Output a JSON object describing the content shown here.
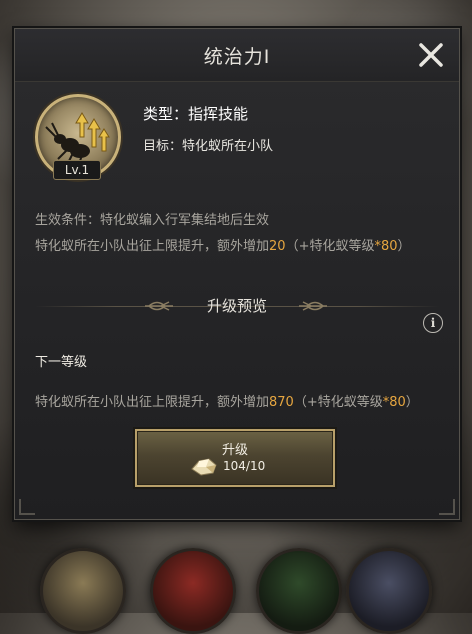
{
  "dialog": {
    "title": "统治力I",
    "close_icon": "close-icon"
  },
  "skill": {
    "level": "Lv.1",
    "type_text": "类型：指挥技能",
    "target_text": "目标：特化蚁所在小队",
    "icon": "ant-arrows-up-icon"
  },
  "current_effect": {
    "condition_text": "生效条件：特化蚁编入行军集结地后生效",
    "bonus_prefix": "特化蚁所在小队出征上限提升，额外增加",
    "bonus_value": "20",
    "bonus_formula_prefix": "（+特化蚁等级",
    "bonus_multiplier": "*80",
    "bonus_formula_suffix": "）"
  },
  "preview": {
    "section_title": "升级预览",
    "next_level_label": "下一等级",
    "bonus_prefix": "特化蚁所在小队出征上限提升，额外增加",
    "bonus_value": "870",
    "bonus_formula_prefix": "（+特化蚁等级",
    "bonus_multiplier": "*80",
    "bonus_formula_suffix": "）",
    "info_icon": "info-icon"
  },
  "upgrade_button": {
    "label": "升级",
    "cost_text": "104/10",
    "cost_icon": "resource-crystal-icon"
  },
  "colors": {
    "highlight": "#e6a640",
    "body_text": "#a8a59e",
    "button_border": "#b8a06a"
  }
}
